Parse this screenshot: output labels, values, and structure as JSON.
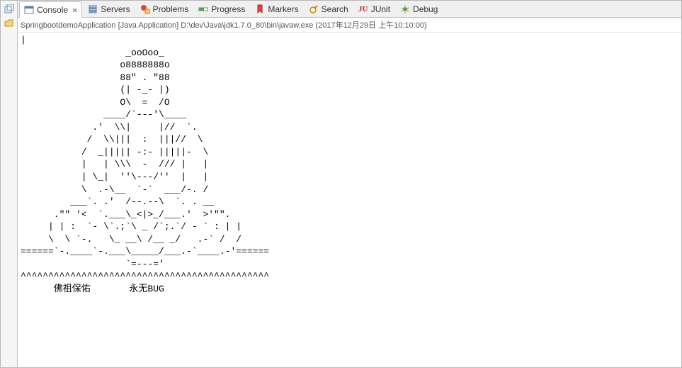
{
  "leftbar": {
    "icon1": "restore",
    "icon2": "folder"
  },
  "tabs": [
    {
      "label": "Console",
      "icon": "console",
      "active": true,
      "closeable": true
    },
    {
      "label": "Servers",
      "icon": "servers",
      "active": false
    },
    {
      "label": "Problems",
      "icon": "problems",
      "active": false
    },
    {
      "label": "Progress",
      "icon": "progress",
      "active": false
    },
    {
      "label": "Markers",
      "icon": "markers",
      "active": false
    },
    {
      "label": "Search",
      "icon": "search",
      "active": false
    },
    {
      "label": "JUnit",
      "icon": "junit",
      "active": false
    },
    {
      "label": "Debug",
      "icon": "debug",
      "active": false
    }
  ],
  "header": {
    "text": "SpringbootdemoApplication [Java Application] D:\\dev\\Java\\jdk1.7.0_80\\bin\\javaw.exe (2017年12月29日 上午10:10:00)"
  },
  "console": {
    "output": "|\n                   _ooOoo_\n                  o8888888o\n                  88\" . \"88\n                  (| -_- |)\n                  O\\  =  /O\n               ____/`---'\\____\n             .'  \\\\|     |//  `.\n            /  \\\\|||  :  |||//  \\\n           /  _||||| -:- |||||-  \\\n           |   | \\\\\\  -  /// |   |\n           | \\_|  ''\\---/''  |   |\n           \\  .-\\__  `-`  ___/-. /\n         ___`. .'  /--.--\\  `. . __\n      .\"\" '<  `.___\\_<|>_/___.'  >'\"\".\n     | | :  `- \\`.;`\\ _ /`;.`/ - ` : | |\n     \\  \\ `-.   \\_ __\\ /__ _/   .-` /  /\n======`-.____`-.___\\_____/___.-`____.-'======\n                   `=---='\n^^^^^^^^^^^^^^^^^^^^^^^^^^^^^^^^^^^^^^^^^^^^^\n      佛祖保佑       永无BUG"
  }
}
